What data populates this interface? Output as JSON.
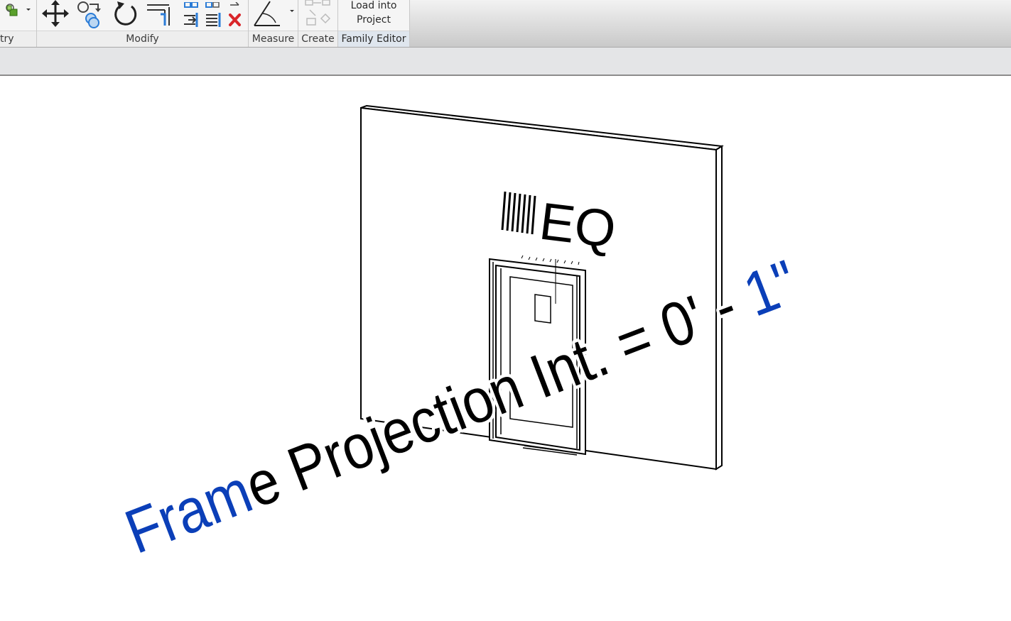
{
  "ribbon": {
    "panels": {
      "geometry": {
        "label": "try"
      },
      "modify": {
        "label": "Modify"
      },
      "measure": {
        "label": "Measure"
      },
      "create": {
        "label": "Create"
      },
      "family_editor": {
        "label": "Family Editor",
        "load_into_project": {
          "line1": "Load into",
          "line2": "Project"
        }
      }
    },
    "icons": {
      "join": "join-geometry-icon",
      "move": "move-icon",
      "copy": "copy-icon",
      "rotate": "rotate-icon",
      "trim": "trim-extend-icon",
      "array": "array-icon",
      "scale": "scale-icon",
      "split": "split-icon",
      "offset": "offset-icon",
      "delete": "delete-icon",
      "measure": "aligned-dimension-icon",
      "create": "create-group-icon"
    }
  },
  "viewport": {
    "eq_label": "EQ",
    "parameter_label": {
      "blue_start": "Fram",
      "black_middle": "e Projection Int. = 0' - ",
      "blue_end": "1\""
    }
  },
  "colors": {
    "accent_blue": "#0b3fb8",
    "delete_red": "#d9252a",
    "icon_blue": "#2a7bd6",
    "ribbon_bg": "#f5f5f5",
    "options_bar_bg": "#e4e5e7"
  }
}
